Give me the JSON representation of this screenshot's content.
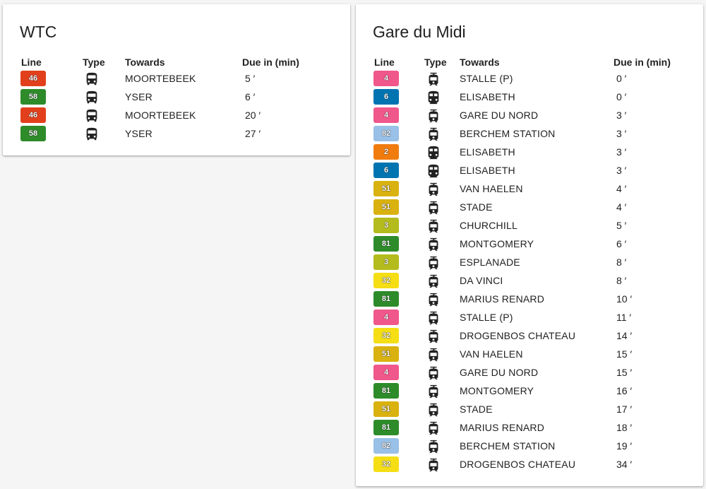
{
  "headers": {
    "line": "Line",
    "type": "Type",
    "towards": "Towards",
    "due": "Due in (min)"
  },
  "stops": [
    {
      "title": "WTC",
      "rows": [
        {
          "line": "46",
          "color": "#e2401c",
          "type": "bus",
          "towards": "MOORTEBEEK",
          "due": "5 ′"
        },
        {
          "line": "58",
          "color": "#2e8b2a",
          "type": "bus",
          "towards": "YSER",
          "due": "6 ′"
        },
        {
          "line": "46",
          "color": "#e2401c",
          "type": "bus",
          "towards": "MOORTEBEEK",
          "due": "20 ′"
        },
        {
          "line": "58",
          "color": "#2e8b2a",
          "type": "bus",
          "towards": "YSER",
          "due": "27 ′"
        }
      ]
    },
    {
      "title": "Gare du Midi",
      "rows": [
        {
          "line": "4",
          "color": "#f0578a",
          "type": "tram",
          "towards": "STALLE (P)",
          "due": "0 ′"
        },
        {
          "line": "6",
          "color": "#0074b0",
          "type": "metro",
          "towards": "ELISABETH",
          "due": "0 ′"
        },
        {
          "line": "4",
          "color": "#f0578a",
          "type": "tram",
          "towards": "GARE DU NORD",
          "due": "3 ′"
        },
        {
          "line": "82",
          "color": "#99c0e6",
          "type": "tram",
          "towards": "BERCHEM STATION",
          "due": "3 ′"
        },
        {
          "line": "2",
          "color": "#f17c0e",
          "type": "metro",
          "towards": "ELISABETH",
          "due": "3 ′"
        },
        {
          "line": "6",
          "color": "#0074b0",
          "type": "metro",
          "towards": "ELISABETH",
          "due": "3 ′"
        },
        {
          "line": "51",
          "color": "#d9b20f",
          "type": "tram",
          "towards": "VAN HAELEN",
          "due": "4 ′"
        },
        {
          "line": "51",
          "color": "#d9b20f",
          "type": "tram",
          "towards": "STADE",
          "due": "4 ′"
        },
        {
          "line": "3",
          "color": "#b4bb1c",
          "type": "tram",
          "towards": "CHURCHILL",
          "due": "5 ′"
        },
        {
          "line": "81",
          "color": "#2e8b2a",
          "type": "tram",
          "towards": "MONTGOMERY",
          "due": "6 ′"
        },
        {
          "line": "3",
          "color": "#b4bb1c",
          "type": "tram",
          "towards": "ESPLANADE",
          "due": "8 ′"
        },
        {
          "line": "32",
          "color": "#f5de14",
          "type": "tram",
          "towards": "DA VINCI",
          "due": "8 ′"
        },
        {
          "line": "81",
          "color": "#2e8b2a",
          "type": "tram",
          "towards": "MARIUS RENARD",
          "due": "10 ′"
        },
        {
          "line": "4",
          "color": "#f0578a",
          "type": "tram",
          "towards": "STALLE (P)",
          "due": "11 ′"
        },
        {
          "line": "32",
          "color": "#f5de14",
          "type": "tram",
          "towards": "DROGENBOS CHATEAU",
          "due": "14 ′"
        },
        {
          "line": "51",
          "color": "#d9b20f",
          "type": "tram",
          "towards": "VAN HAELEN",
          "due": "15 ′"
        },
        {
          "line": "4",
          "color": "#f0578a",
          "type": "tram",
          "towards": "GARE DU NORD",
          "due": "15 ′"
        },
        {
          "line": "81",
          "color": "#2e8b2a",
          "type": "tram",
          "towards": "MONTGOMERY",
          "due": "16 ′"
        },
        {
          "line": "51",
          "color": "#d9b20f",
          "type": "tram",
          "towards": "STADE",
          "due": "17 ′"
        },
        {
          "line": "81",
          "color": "#2e8b2a",
          "type": "tram",
          "towards": "MARIUS RENARD",
          "due": "18 ′"
        },
        {
          "line": "82",
          "color": "#99c0e6",
          "type": "tram",
          "towards": "BERCHEM STATION",
          "due": "19 ′"
        },
        {
          "line": "32",
          "color": "#f5de14",
          "type": "tram",
          "towards": "DROGENBOS CHATEAU",
          "due": "34 ′"
        }
      ]
    }
  ]
}
